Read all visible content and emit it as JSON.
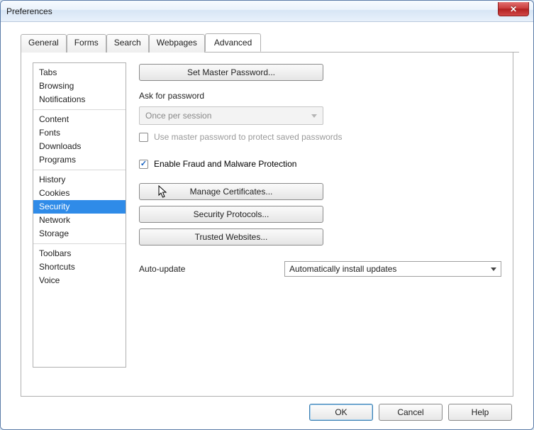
{
  "window": {
    "title": "Preferences"
  },
  "tabs": {
    "items": [
      "General",
      "Forms",
      "Search",
      "Webpages",
      "Advanced"
    ],
    "active_index": 4
  },
  "sidebar": {
    "groups": [
      [
        "Tabs",
        "Browsing",
        "Notifications"
      ],
      [
        "Content",
        "Fonts",
        "Downloads",
        "Programs"
      ],
      [
        "History",
        "Cookies",
        "Security",
        "Network",
        "Storage"
      ],
      [
        "Toolbars",
        "Shortcuts",
        "Voice"
      ]
    ],
    "selected": "Security"
  },
  "content": {
    "set_master_password_btn": "Set Master Password...",
    "ask_for_password_label": "Ask for password",
    "ask_for_password_value": "Once per session",
    "use_master_password_checkbox": {
      "label": "Use master password to protect saved passwords",
      "checked": false,
      "enabled": false
    },
    "enable_protection_checkbox": {
      "label": "Enable Fraud and Malware Protection",
      "checked": true
    },
    "manage_certificates_btn": "Manage Certificates...",
    "security_protocols_btn": "Security Protocols...",
    "trusted_websites_btn": "Trusted Websites...",
    "auto_update_label": "Auto-update",
    "auto_update_value": "Automatically install updates"
  },
  "footer": {
    "ok": "OK",
    "cancel": "Cancel",
    "help": "Help"
  }
}
